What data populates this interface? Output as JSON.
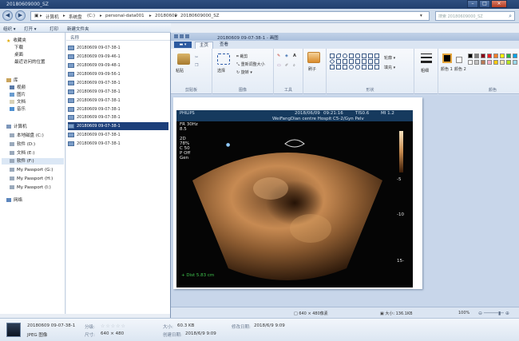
{
  "explorer": {
    "title": "20180609000_SZ",
    "window_buttons": [
      "–",
      "□",
      "×"
    ],
    "address": {
      "segments": [
        "计算机",
        "系统盘",
        "(C:)",
        "personal-data001",
        "20180609",
        "20180609000_SZ"
      ],
      "search_placeholder": "搜索 20180609000_SZ"
    },
    "toolbar": {
      "organize": "组织 ▾",
      "open": "打开 ▾",
      "print": "打印",
      "new_folder": "新建文件夹"
    },
    "nav": {
      "favorites": "收藏夹",
      "downloads": "下载",
      "desktop": "桌面",
      "recent": "最近访问的位置",
      "libraries": "库",
      "videos": "视频",
      "pictures": "图片",
      "documents": "文档",
      "music": "音乐",
      "computer": "计算机",
      "drives": [
        "本地磁盘 (C:)",
        "软件 (D:)",
        "文档 (E:)",
        "软件 (F:)",
        "My Passport (G:)",
        "My Passport (H:)",
        "My Passport (I:)"
      ],
      "network": "网络"
    },
    "filelist": {
      "header": "名称",
      "files": [
        "20180609 09-07-38-1",
        "20180609 09-09-46-1",
        "20180609 09-09-48-1",
        "20180609 09-09-56-1",
        "20180609 09-07-38-1",
        "20180609 09-07-38-1",
        "20180609 09-07-38-1",
        "20180609 09-07-38-1",
        "20180609 09-07-38-1",
        "20180609 09-07-38-1",
        "20180609 09-07-38-1",
        "20180609 09-07-38-1"
      ],
      "selected_index": 8
    }
  },
  "paint": {
    "title": "20180609 09-07-38-1 - 画图",
    "file_tab": "▬ ▾",
    "tabs": [
      "主页",
      "查看"
    ],
    "groups": {
      "clipboard": "剪贴板",
      "paste": "粘贴",
      "image": "图像",
      "select": "选择",
      "crop": "裁剪",
      "resize": "重新调整大小",
      "rotate": "旋转 ▾",
      "tools": "工具",
      "brushes": "刷子",
      "shapes": "形状",
      "outline": "轮廓 ▾",
      "fill": "填充 ▾",
      "size": "粗细",
      "color1": "颜色 1",
      "color2": "颜色 2",
      "colors": "颜色"
    },
    "palette": [
      "#000000",
      "#7f7f7f",
      "#880015",
      "#ed1c24",
      "#ff7f27",
      "#fff200",
      "#22b14c",
      "#00a2e8",
      "#ffffff",
      "#c3c3c3",
      "#b97a57",
      "#ffaec9",
      "#ffc90e",
      "#efe4b0",
      "#b5e61d",
      "#99d9ea"
    ],
    "status": {
      "position": "",
      "selection": "□ 640 × 480像素",
      "size": "▣ 大小: 136.1KB",
      "zoom": "100%"
    }
  },
  "ultrasound": {
    "brand": "PHILIPS",
    "date": "2018/06/09",
    "time": "09:21:16",
    "tis": "TIS0.6",
    "mi": "MI 1.2",
    "hospital": "WeiFangDian centre Hospit C5-2/Gyn Pelv",
    "params": [
      "FR 30Hz",
      "8.5",
      "",
      "2D",
      "78%",
      "C 50",
      "P Off",
      "Gen"
    ],
    "scale_marks": [
      "-5",
      "-10",
      "15-"
    ],
    "measurement": "+ Dist  5.83 cm"
  },
  "details": {
    "filename": "20180609 09-07-38-1",
    "type": "JPEG 图像",
    "rating_label": "分级:",
    "rating_stars": "☆☆☆☆☆",
    "dimensions_label": "尺寸:",
    "dimensions": "640 × 480",
    "size_label": "大小:",
    "size": "60.3 KB",
    "created_label": "创建日期:",
    "created": "2018/6/9 9:09",
    "modified_label": "修改日期:",
    "modified": "2018/6/9 9:09"
  }
}
